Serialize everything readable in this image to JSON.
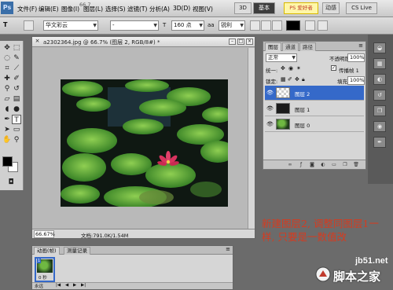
{
  "app": {
    "logo_text": "Ps"
  },
  "menubar": {
    "items": [
      "文件(F)",
      "编辑(E)",
      "图像(I)",
      "图层(L)",
      "选择(S)",
      "滤镜(T)",
      "分析(A)",
      "3D(D)",
      "视图(V)"
    ],
    "zoom": "66.7",
    "btn_3d": "3D",
    "btn_essentials": "基本",
    "btn_design": "设计",
    "btn_motion": "动感",
    "badge_text": "PS 爱好者",
    "cs_live": "CS Live"
  },
  "options": {
    "tool_glyph": "T",
    "font_family": "华文彩云",
    "font_style": "-",
    "size": "160 点",
    "aa_label": "aa",
    "aa": "锐利",
    "color_swatch": "#000000"
  },
  "document": {
    "title": "a2302364.jpg @ 66.7% (图层 2, RGB/8#) *",
    "zoom_field": "66.67%",
    "doc_info": "文档:791.0K/1.54M"
  },
  "layers_panel": {
    "tabs": [
      "图层",
      "通道",
      "路径"
    ],
    "blend_mode": "正常",
    "opacity_label": "不透明度:",
    "opacity": "100%",
    "unify_label": "统一:",
    "propagate_label": "传播帧 1",
    "lock_label": "锁定:",
    "fill_label": "填充:",
    "fill": "100%",
    "layers": [
      {
        "name": "图层 2",
        "selected": true,
        "thumb": "transparent"
      },
      {
        "name": "图层 1",
        "selected": false,
        "thumb": "dark"
      },
      {
        "name": "图层 0",
        "selected": false,
        "thumb": "photo"
      }
    ],
    "bottom_icons": [
      "link-icon",
      "fx-icon",
      "mask-icon",
      "adjustment-icon",
      "folder-icon",
      "new-layer-icon",
      "trash-icon"
    ]
  },
  "animation_panel": {
    "tabs": [
      "动画(帧)",
      "测量记录"
    ],
    "frame_number": "1",
    "frame_delay": "0 秒",
    "loop": "永远"
  },
  "annotation": "新建图层2, 调整同图层1一样, 只要是一数值改",
  "watermark": {
    "site": "jb51.net",
    "name": "脚本之家"
  },
  "colors": {
    "selection_blue": "#3569c9",
    "annotation_red": "#d63b1f",
    "ui_gray": "#d6d6d6"
  }
}
